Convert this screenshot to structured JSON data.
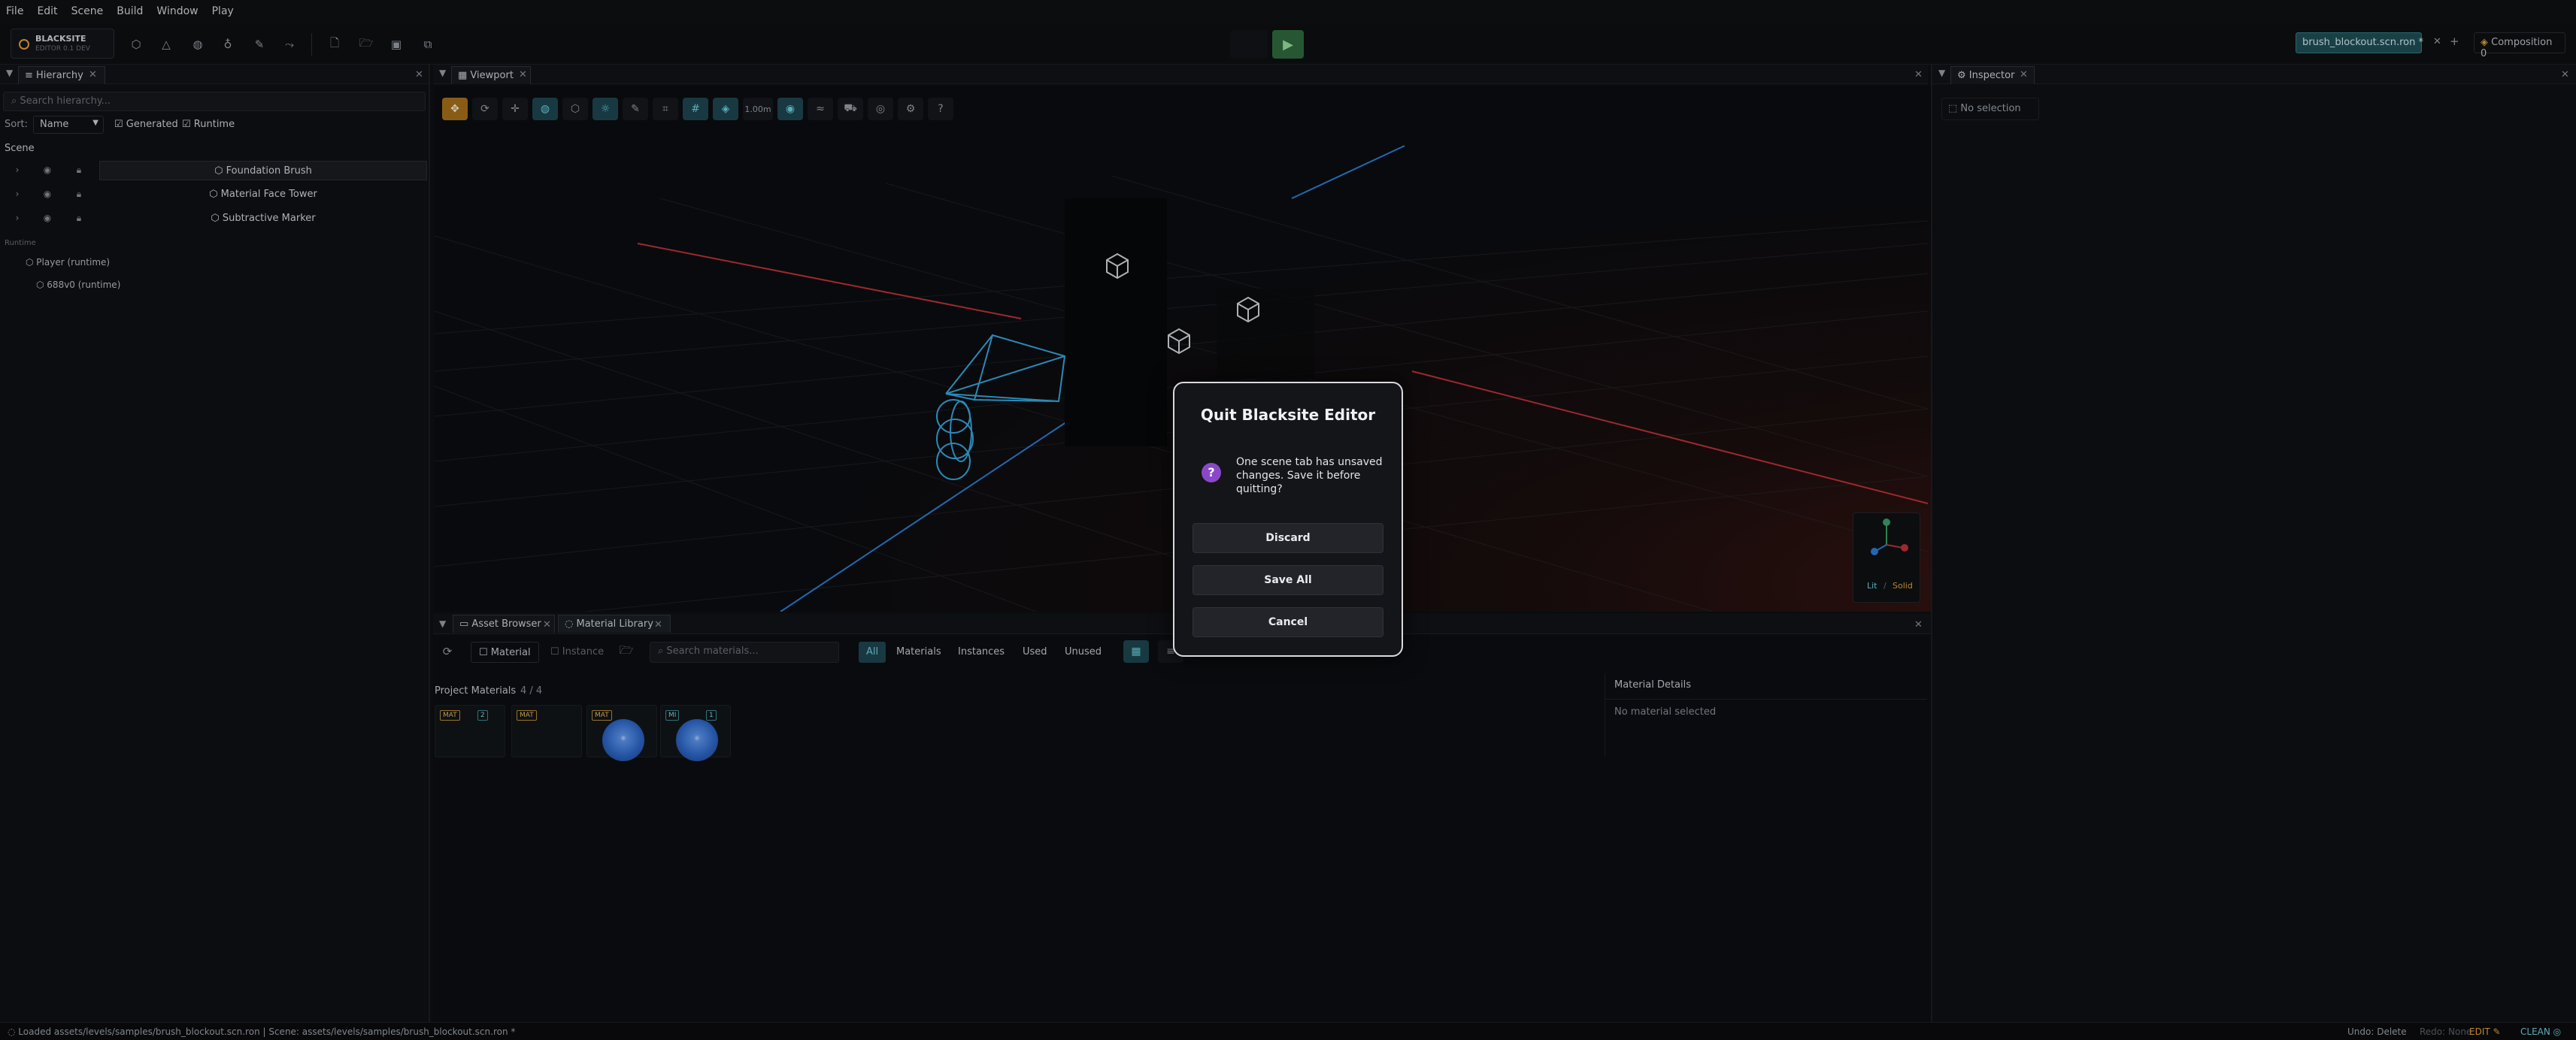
{
  "menu": [
    "File",
    "Edit",
    "Scene",
    "Build",
    "Window",
    "Play"
  ],
  "app": {
    "name": "BLACKSITE",
    "subtitle": "EDITOR 0.1 DEV"
  },
  "toolbar": {
    "doc_tab": "brush_blockout.scn.ron *",
    "composition": "Composition 0"
  },
  "hierarchy": {
    "tab": "Hierarchy",
    "search_placeholder": "Search hierarchy...",
    "sort_label": "Sort:",
    "sort_value": "Name",
    "generated": "Generated",
    "runtime": "Runtime",
    "scene_label": "Scene",
    "items": [
      "Foundation Brush",
      "Material Face Tower",
      "Subtractive Marker"
    ],
    "runtime_label": "Runtime",
    "runtime_items": [
      "Player (runtime)",
      "688v0 (runtime)"
    ]
  },
  "viewport": {
    "tab": "Viewport",
    "grid_size": "1.00m",
    "mode_lit": "Lit",
    "mode_solid": "Solid"
  },
  "bottom": {
    "tabs": [
      "Asset Browser",
      "Material Library"
    ],
    "material_btn": "Material",
    "instance_btn": "Instance",
    "search_placeholder": "Search materials...",
    "filters": [
      "All",
      "Materials",
      "Instances",
      "Used",
      "Unused"
    ],
    "project_materials": "Project Materials",
    "count": "4  /  4",
    "details_title": "Material Details",
    "details_empty": "No material selected",
    "thumb_tags": [
      "MAT",
      "MAT",
      "MAT",
      "MI"
    ],
    "thumb_badges": [
      "2",
      "",
      "",
      "1"
    ]
  },
  "inspector": {
    "tab": "Inspector",
    "empty": "No selection"
  },
  "dialog": {
    "title": "Quit Blacksite Editor",
    "message": "One scene tab has unsaved changes. Save it before quitting?",
    "discard": "Discard",
    "save_all": "Save All",
    "cancel": "Cancel"
  },
  "status": {
    "left": "Loaded assets/levels/samples/brush_blockout.scn.ron  |  Scene: assets/levels/samples/brush_blockout.scn.ron *",
    "undo": "Undo: Delete",
    "redo": "Redo: None",
    "mode": "EDIT",
    "state": "CLEAN"
  },
  "colors": {
    "accent": "#2e7d86",
    "play": "#2f6b3d",
    "warn": "#a8711c",
    "dialog_icon": "#8a48c9"
  }
}
